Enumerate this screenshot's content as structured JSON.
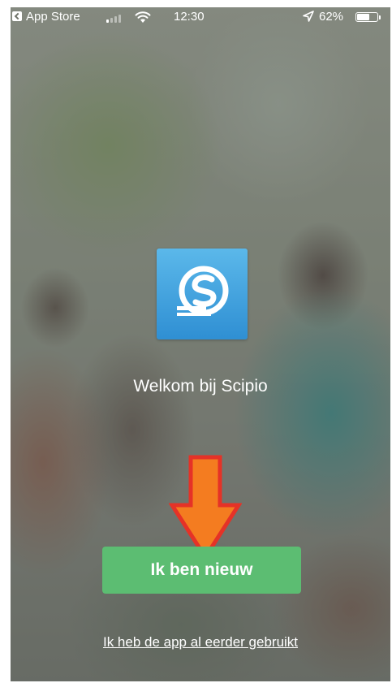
{
  "status_bar": {
    "back_app": "App Store",
    "time": "12:30",
    "battery": "62%",
    "battery_level": 0.62,
    "icons": [
      "back-arrow-icon",
      "cellular-signal-icon",
      "wifi-icon",
      "location-arrow-icon",
      "battery-icon"
    ]
  },
  "welcome": {
    "logo_icon": "scipio-logo-icon",
    "title": "Welkom bij Scipio"
  },
  "annotation": {
    "icon": "down-arrow-icon",
    "fill_color": "#f47c20",
    "outline_color": "#e53227"
  },
  "actions": {
    "primary_label": "Ik ben nieuw",
    "secondary_label": "Ik heb de app al eerder gebruikt"
  },
  "colors": {
    "primary_button": "#5cbd72",
    "logo_blue": "#3a9ad9"
  }
}
